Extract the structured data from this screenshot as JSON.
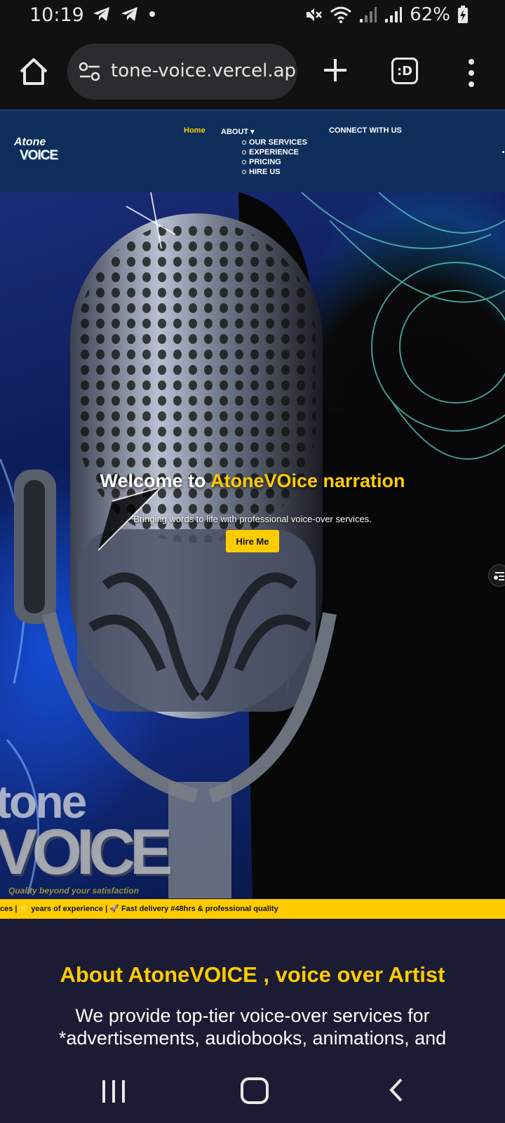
{
  "status_bar": {
    "time": "10:19",
    "battery": "62%",
    "icons": [
      "telegram-icon",
      "telegram-icon",
      "dot-icon",
      "mute-icon",
      "wifi-icon",
      "signal-icon",
      "signal-icon",
      "battery-charging-icon"
    ]
  },
  "browser": {
    "url": "tone-voice.vercel.app",
    "tabs_label": ":D"
  },
  "site_nav": {
    "logo_line1": "Atone",
    "logo_line2": "VOICE",
    "home": "Home",
    "about": "ABOUT ▾",
    "about_items": [
      "OUR SERVICES",
      "EXPERIENCE",
      "PRICING",
      "HIRE US"
    ],
    "connect": "CONNECT WITH US"
  },
  "hero": {
    "title_prefix": "Welcome to ",
    "title_accent": "AtoneVOice narration",
    "subtitle": "Bringing words to life with professional voice-over services.",
    "cta": "Hire Me",
    "watermark_line1": "tone",
    "watermark_line2": "VOICE",
    "watermark_tagline": "Quality beyond your satisfaction"
  },
  "ticker": {
    "text": "ces | ⭐ years of experience | 🚀 Fast delivery #48hrs & professional quality"
  },
  "about": {
    "title": "About AtoneVOICE , voice over Artist",
    "text": "We provide top-tier voice-over services for *advertisements, audiobooks, animations, and"
  },
  "colors": {
    "accent": "#ffcc00",
    "nav_bg": "#0e2f5c",
    "page_bg": "#1b1b33"
  }
}
